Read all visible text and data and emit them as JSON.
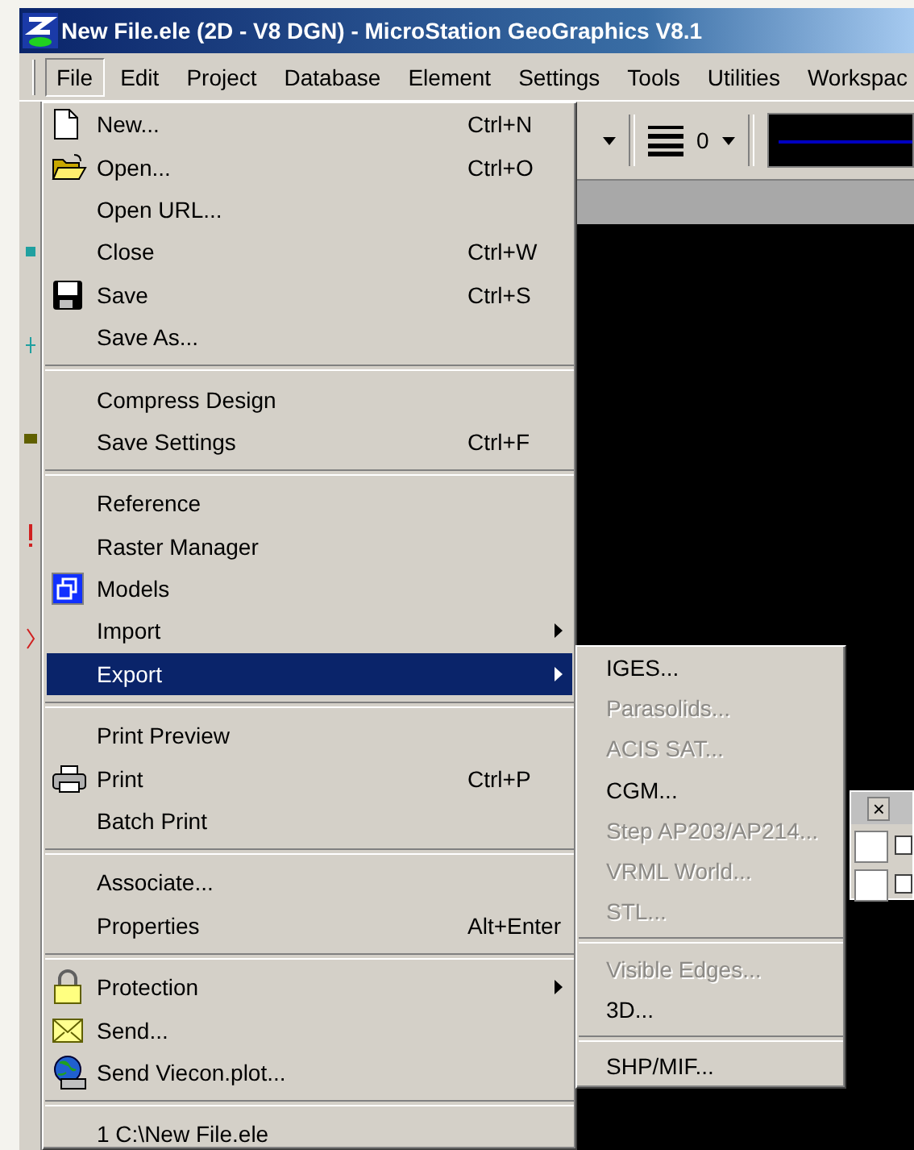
{
  "window": {
    "title": "New File.ele (2D - V8 DGN) - MicroStation GeoGraphics V8.1"
  },
  "menu_bar": [
    {
      "label": "File",
      "selected": true
    },
    {
      "label": "Edit",
      "selected": false
    },
    {
      "label": "Project",
      "selected": false
    },
    {
      "label": "Database",
      "selected": false
    },
    {
      "label": "Element",
      "selected": false
    },
    {
      "label": "Settings",
      "selected": false
    },
    {
      "label": "Tools",
      "selected": false
    },
    {
      "label": "Utilities",
      "selected": false
    },
    {
      "label": "Workspac",
      "selected": false
    }
  ],
  "toolbar": {
    "line_weight": "0"
  },
  "file_menu": {
    "sections": [
      {
        "items": [
          {
            "label": "New...",
            "shortcut": "Ctrl+N",
            "kind": "document",
            "submenu": false,
            "selected": false
          },
          {
            "label": "Open...",
            "shortcut": "Ctrl+O",
            "kind": "folder",
            "submenu": false,
            "selected": false
          },
          {
            "label": "Open URL...",
            "kind": "plain",
            "submenu": false,
            "selected": false
          },
          {
            "label": "Close",
            "shortcut": "Ctrl+W",
            "kind": "plain",
            "submenu": false,
            "selected": false
          },
          {
            "label": "Save",
            "shortcut": "Ctrl+S",
            "kind": "floppy",
            "submenu": false,
            "selected": false
          },
          {
            "label": "Save As...",
            "kind": "plain",
            "submenu": false,
            "selected": false
          }
        ]
      },
      {
        "items": [
          {
            "label": "Compress Design",
            "kind": "plain",
            "submenu": false,
            "selected": false
          },
          {
            "label": "Save Settings",
            "shortcut": "Ctrl+F",
            "kind": "plain",
            "submenu": false,
            "selected": false
          }
        ]
      },
      {
        "items": [
          {
            "label": "Reference",
            "kind": "plain",
            "submenu": false,
            "selected": false
          },
          {
            "label": "Raster Manager",
            "kind": "plain",
            "submenu": false,
            "selected": false
          },
          {
            "label": "Models",
            "kind": "models",
            "submenu": false,
            "selected": false
          },
          {
            "label": "Import",
            "kind": "plain",
            "submenu": true,
            "selected": false
          },
          {
            "label": "Export",
            "kind": "plain",
            "submenu": true,
            "selected": true
          }
        ]
      },
      {
        "items": [
          {
            "label": "Print Preview",
            "kind": "plain",
            "submenu": false,
            "selected": false
          },
          {
            "label": "Print",
            "shortcut": "Ctrl+P",
            "kind": "printer",
            "submenu": false,
            "selected": false
          },
          {
            "label": "Batch Print",
            "kind": "plain",
            "submenu": false,
            "selected": false
          }
        ]
      },
      {
        "items": [
          {
            "label": "Associate...",
            "kind": "plain",
            "submenu": false,
            "selected": false
          },
          {
            "label": "Properties",
            "shortcut": "Alt+Enter",
            "kind": "plain",
            "submenu": false,
            "selected": false
          }
        ]
      },
      {
        "items": [
          {
            "label": "Protection",
            "kind": "lock",
            "submenu": true,
            "selected": false
          },
          {
            "label": "Send...",
            "kind": "envelope",
            "submenu": false,
            "selected": false
          },
          {
            "label": "Send Viecon.plot...",
            "kind": "globe",
            "submenu": false,
            "selected": false
          }
        ]
      },
      {
        "items": [
          {
            "label": "1 C:\\New File.ele",
            "kind": "plain",
            "submenu": false,
            "selected": false
          }
        ]
      }
    ]
  },
  "export_submenu": {
    "sections": [
      {
        "items": [
          {
            "label": "IGES...",
            "disabled": false
          },
          {
            "label": "Parasolids...",
            "disabled": true
          },
          {
            "label": "ACIS SAT...",
            "disabled": true
          },
          {
            "label": "CGM...",
            "disabled": false
          },
          {
            "label": "Step AP203/AP214...",
            "disabled": true
          },
          {
            "label": "VRML World...",
            "disabled": true
          },
          {
            "label": "STL...",
            "disabled": true
          }
        ]
      },
      {
        "items": [
          {
            "label": "Visible Edges...",
            "disabled": true
          },
          {
            "label": "3D...",
            "disabled": false
          }
        ]
      },
      {
        "items": [
          {
            "label": "SHP/MIF...",
            "disabled": false
          }
        ]
      }
    ]
  },
  "dialog": {
    "close": "×",
    "checkboxes": [
      {
        "checked": false
      },
      {
        "checked": false
      }
    ]
  }
}
